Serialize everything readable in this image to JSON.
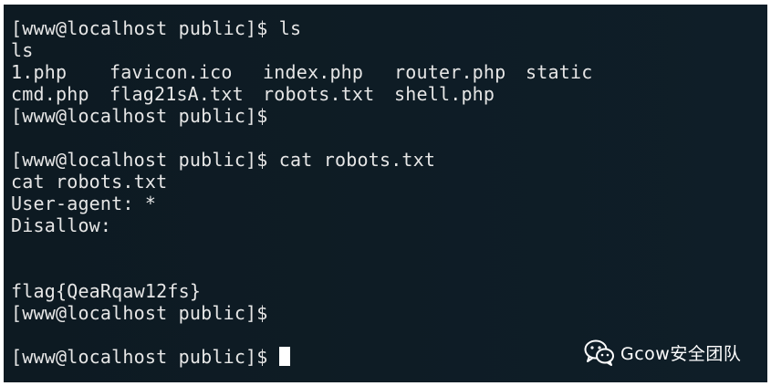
{
  "terminal": {
    "lines": [
      "[www@localhost public]$ ls",
      "ls",
      "",
      "",
      "[www@localhost public]$",
      "",
      "[www@localhost public]$ cat robots.txt",
      "cat robots.txt",
      "User-agent: *",
      "Disallow:",
      "",
      "",
      "flag{QeaRqaw12fs}",
      "[www@localhost public]$",
      "",
      "[www@localhost public]$"
    ],
    "ls_output": {
      "row1": [
        "1.php",
        "favicon.ico",
        "index.php",
        "router.php",
        "static"
      ],
      "row2": [
        "cmd.php",
        "flag21sA.txt",
        "robots.txt",
        "shell.php",
        ""
      ]
    }
  },
  "watermark": {
    "text": "Gcow安全团队",
    "icon": "wechat-icon"
  },
  "colors": {
    "background": "#0e1c25",
    "text": "#e6e6e6",
    "cursor": "#ffffff"
  }
}
